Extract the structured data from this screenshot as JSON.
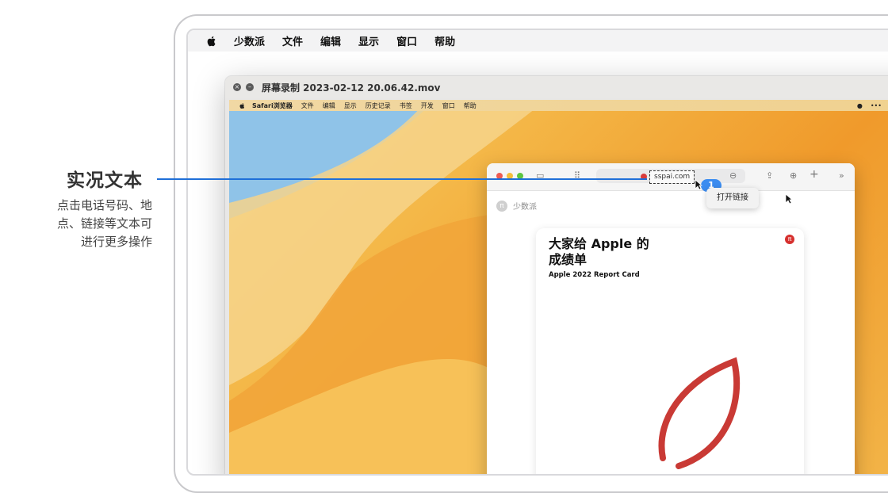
{
  "outer_menubar": {
    "app_name": "少数派",
    "items": [
      "文件",
      "编辑",
      "显示",
      "窗口",
      "帮助"
    ]
  },
  "player": {
    "title": "屏幕录制 2023-02-12 20.06.42.mov"
  },
  "inner_menubar": {
    "app_name": "Safari浏览器",
    "items": [
      "文件",
      "编辑",
      "显示",
      "历史记录",
      "书签",
      "开发",
      "窗口",
      "帮助"
    ]
  },
  "safari": {
    "url": "sspai.com",
    "live_text_count": "1",
    "popup_action": "打开链接",
    "site_name": "少数派",
    "site_logo": "π",
    "card": {
      "title": "大家给 Apple 的成绩单",
      "subtitle": "Apple 2022 Report Card",
      "logo": "π"
    }
  },
  "annotation": {
    "title": "实况文本",
    "description_lines": [
      "点击电话号码、地",
      "点、链接等文本可",
      "进行更多操作"
    ]
  },
  "colors": {
    "accent": "#1f6fd8",
    "card_leaf": "#c93a35",
    "wallpaper": "#f3b141"
  }
}
